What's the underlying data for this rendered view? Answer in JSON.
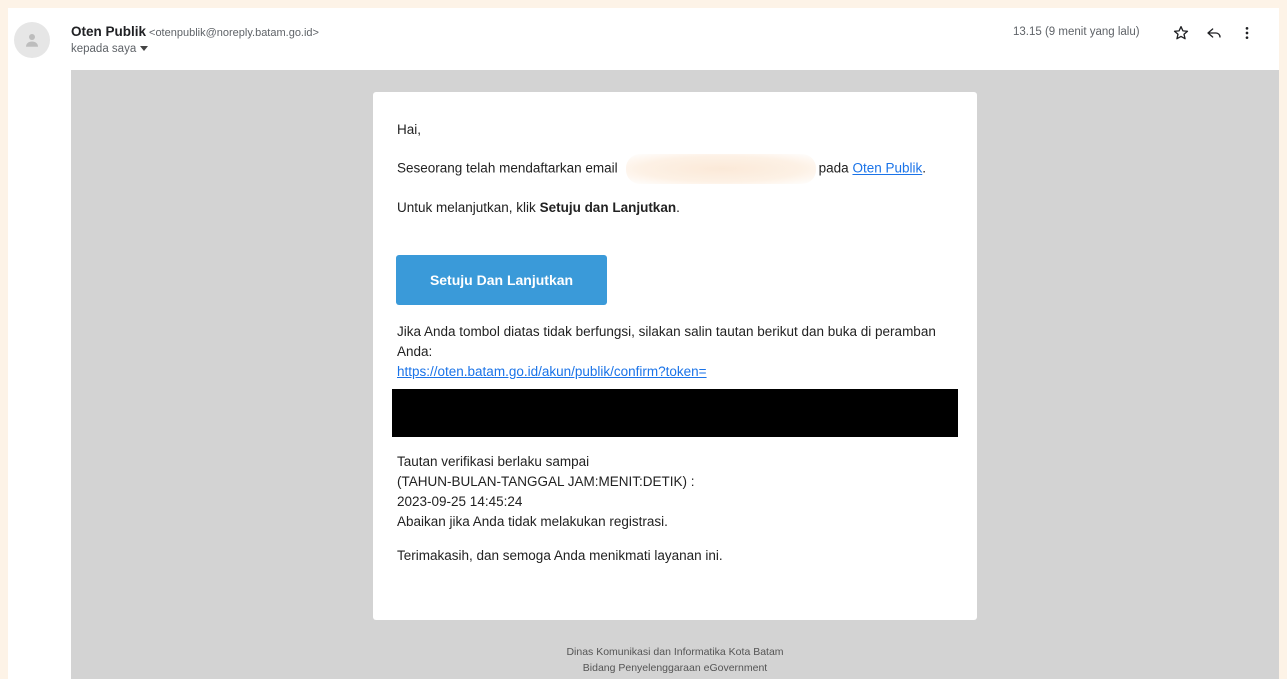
{
  "header": {
    "sender_name": "Oten Publik",
    "sender_email": "<otenpublik@noreply.batam.go.id>",
    "to_label": "kepada saya",
    "timestamp": "13.15 (9 menit yang lalu)",
    "icons": [
      "person-icon",
      "chevron-down-icon",
      "star-icon",
      "reply-icon",
      "more-vert-icon"
    ]
  },
  "email": {
    "greeting": "Hai,",
    "registered_prefix": "Seseorang telah mendaftarkan email",
    "registered_on": "pada",
    "link_oten_publik": "Oten Publik",
    "registered_suffix": ".",
    "continue_prefix": "Untuk melanjutkan, klik ",
    "continue_bold": "Setuju dan Lanjutkan",
    "continue_suffix": ".",
    "button_label": "Setuju Dan Lanjutkan",
    "fallback_text": "Jika Anda tombol diatas tidak berfungsi, silakan salin tautan berikut dan buka di peramban Anda:",
    "confirm_link": "https://oten.batam.go.id/akun/publik/confirm?token=",
    "valid_until_label": "Tautan verifikasi berlaku sampai",
    "valid_format": "(TAHUN-BULAN-TANGGAL JAM:MENIT:DETIK) :",
    "valid_datetime": "2023-09-25 14:45:24",
    "ignore_text": "Abaikan jika Anda tidak melakukan registrasi.",
    "thanks_text": "Terimakasih, dan semoga Anda menikmati layanan ini."
  },
  "footer": {
    "line1": "Dinas Komunikasi dan Informatika Kota Batam",
    "line2": "Bidang Penyelenggaraan eGovernment"
  },
  "colors": {
    "accent_button": "#3a9ad9",
    "link": "#1a73e8",
    "email_background": "#d3d3d3",
    "page_border": "#fdf3e7"
  }
}
